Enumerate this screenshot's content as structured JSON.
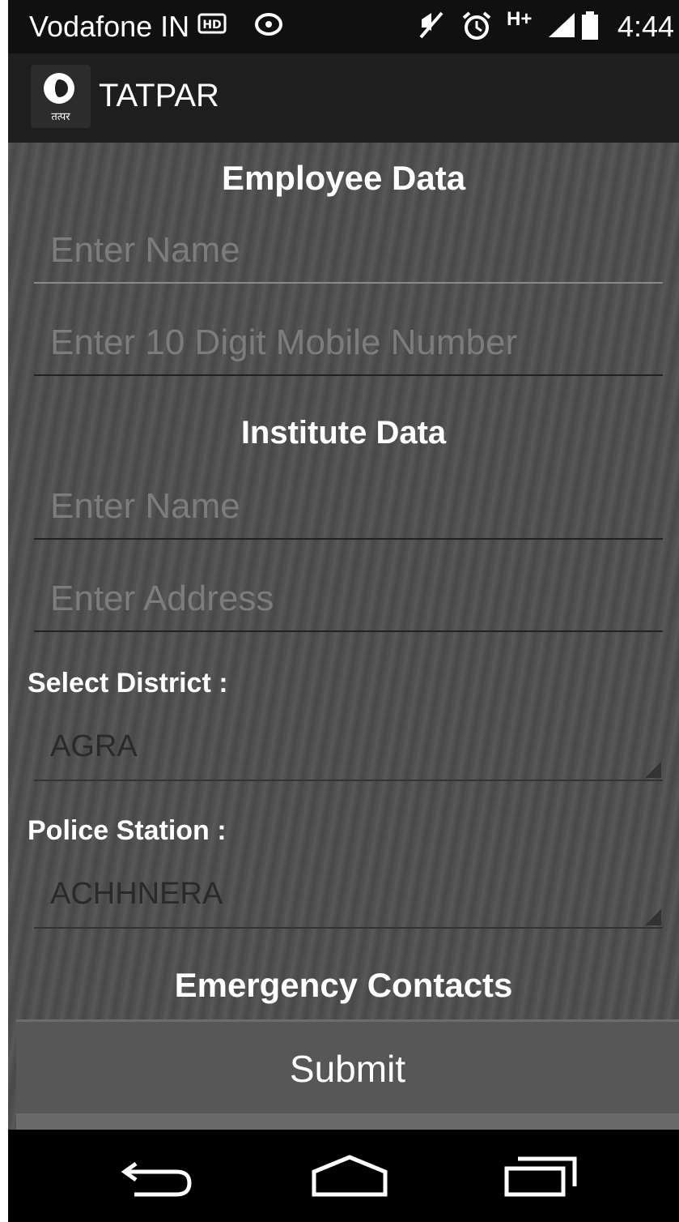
{
  "status_bar": {
    "carrier": "Vodafone IN",
    "icons": [
      "hd-voice-icon",
      "sync-icon",
      "mute-icon",
      "alarm-icon",
      "h-plus-signal-icon",
      "battery-icon"
    ],
    "network_type": "H+",
    "time": "4:44"
  },
  "app_bar": {
    "logo_text": "तत्पर",
    "title": "TATPAR"
  },
  "form": {
    "employee_section_title": "Employee Data",
    "employee_name_placeholder": "Enter Name",
    "employee_mobile_placeholder": "Enter 10 Digit Mobile Number",
    "institute_section_title": "Institute Data",
    "institute_name_placeholder": "Enter Name",
    "institute_address_placeholder": "Enter Address",
    "district_label": "Select District :",
    "district_value": "AGRA",
    "police_station_label": "Police Station :",
    "police_station_value": "ACHHNERA",
    "emergency_section_title": "Emergency Contacts",
    "submit_label": "Submit"
  },
  "nav_bar": {
    "buttons": [
      "back-icon",
      "home-icon",
      "recents-icon"
    ]
  }
}
